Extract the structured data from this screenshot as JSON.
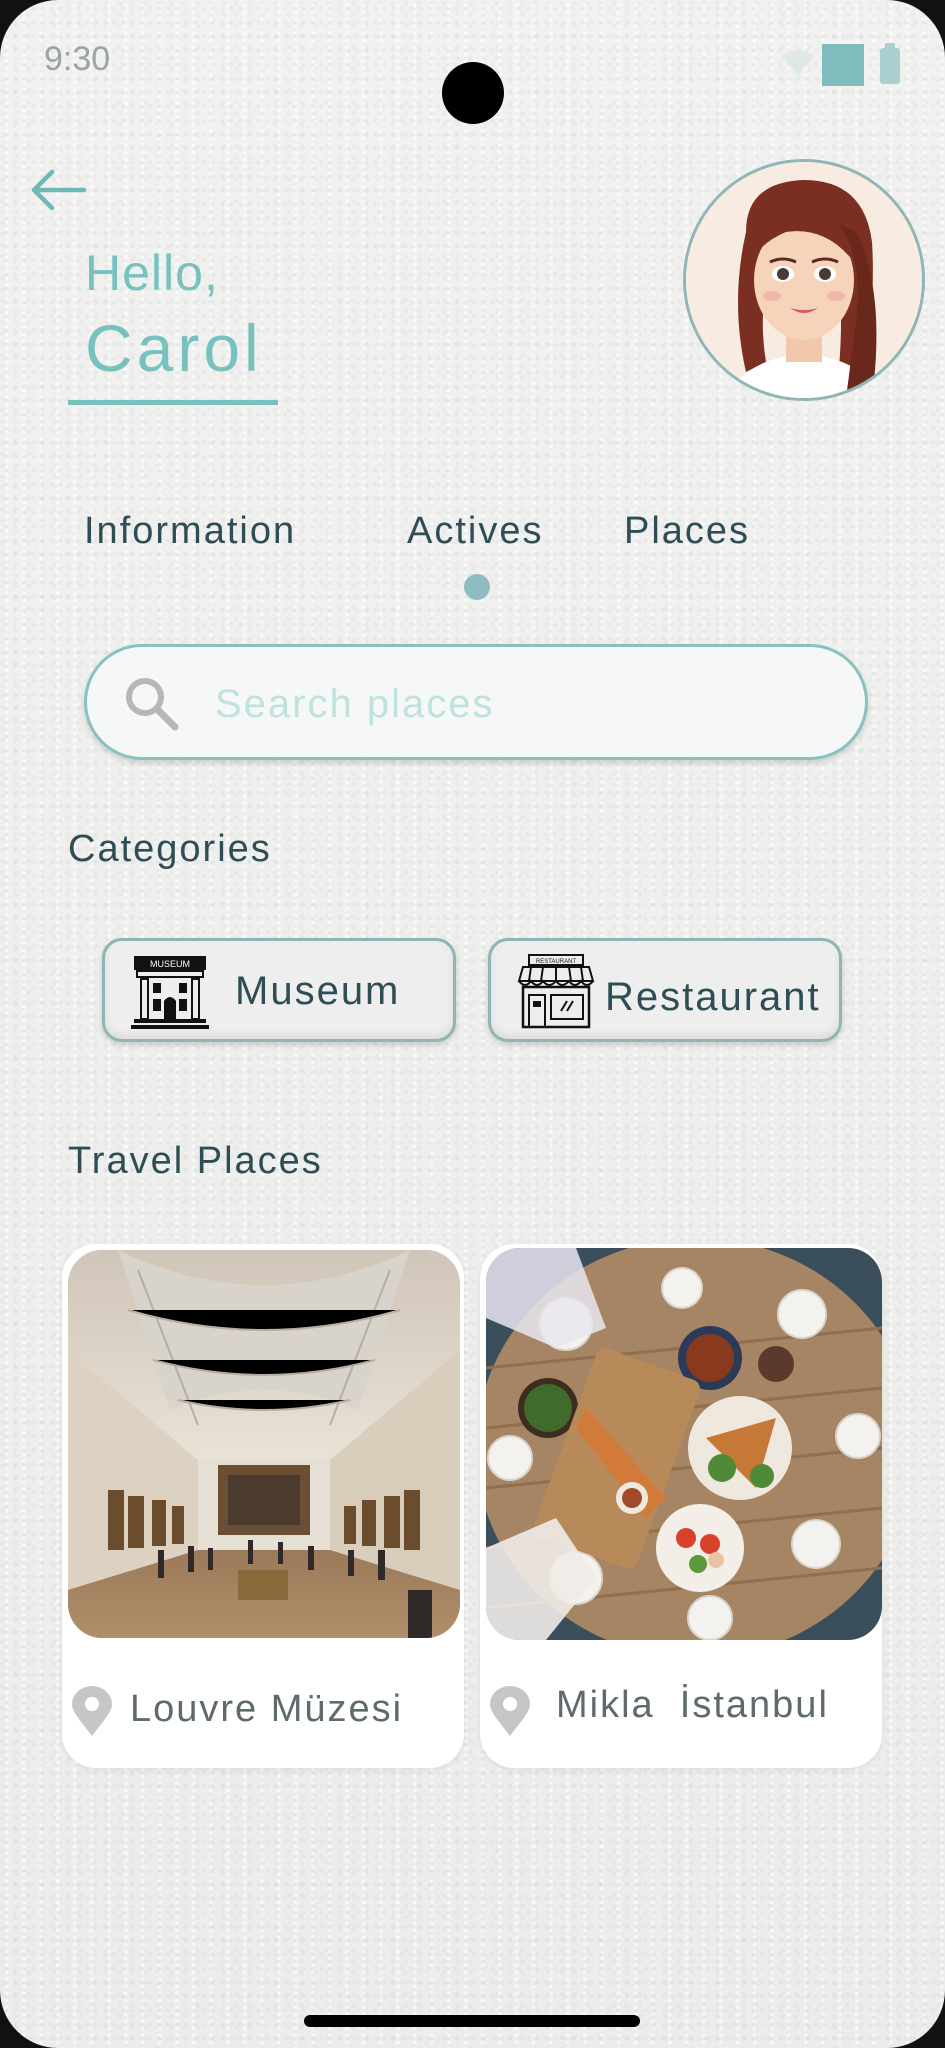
{
  "status_bar": {
    "time": "9:30"
  },
  "header": {
    "hello": "Hello,",
    "name": "Carol"
  },
  "tabs": [
    {
      "label": "Information"
    },
    {
      "label": "Actives",
      "active": true
    },
    {
      "label": "Places"
    }
  ],
  "search": {
    "placeholder": "Search places",
    "value": ""
  },
  "categories": {
    "title": "Categories",
    "items": [
      {
        "label": "Museum",
        "icon": "museum-icon",
        "icon_text": "MUSEUM"
      },
      {
        "label": "Restaurant",
        "icon": "restaurant-icon",
        "icon_text": "RESTAURANT"
      }
    ]
  },
  "travel_places": {
    "title": "Travel Places",
    "items": [
      {
        "name": "Louvre Müzesi",
        "image": "museum gallery hall"
      },
      {
        "name": "Mikla  İstanbul",
        "image": "restaurant table with food"
      }
    ]
  },
  "colors": {
    "accent": "#77c1bf",
    "text": "#2f4d55",
    "muted": "#5f6a6d"
  }
}
